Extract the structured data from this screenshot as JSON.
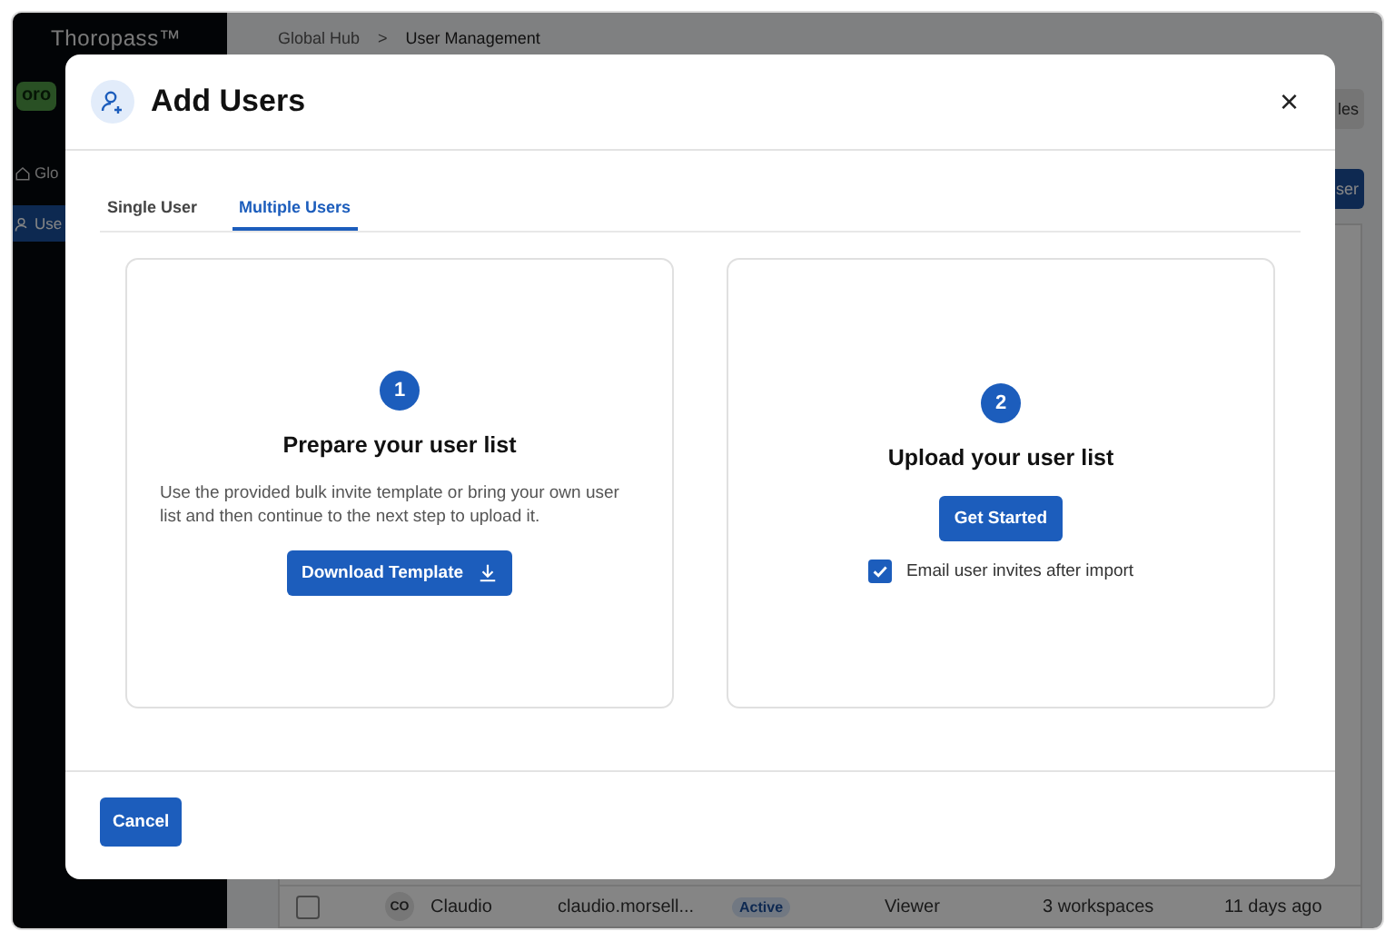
{
  "sidebar": {
    "logo": "Thoropass™",
    "badge": "oro",
    "items": [
      {
        "label": "Glo",
        "kind": "home",
        "selected": false
      },
      {
        "label": "Use",
        "kind": "user",
        "selected": true
      }
    ]
  },
  "breadcrumb": {
    "items": [
      "Global Hub",
      "User Management"
    ],
    "separator": ">"
  },
  "toolbar_buttons": [
    {
      "label": "les",
      "kind": "secondary"
    },
    {
      "label": "ser",
      "kind": "primary"
    }
  ],
  "table_row": {
    "checked": false,
    "initials": "CO",
    "name": "Claudio",
    "email": "claudio.morsell...",
    "status": "Active",
    "role": "Viewer",
    "workspaces": "3 workspaces",
    "last_active": "11 days ago"
  },
  "modal": {
    "title": "Add Users",
    "close": "×",
    "tabs": [
      {
        "label": "Single User",
        "selected": false
      },
      {
        "label": "Multiple Users",
        "selected": true
      }
    ],
    "steps": [
      {
        "number": "1",
        "title": "Prepare your user list",
        "description": "Use the provided bulk invite template or bring your own user list and then continue to the next step to upload it.",
        "button": "Download Template",
        "kind": "download"
      },
      {
        "number": "2",
        "title": "Upload your user list",
        "button": "Get Started",
        "kind": "upload",
        "checkbox": {
          "label": "Email user invites after import",
          "checked": true
        }
      }
    ],
    "cancel": "Cancel"
  }
}
